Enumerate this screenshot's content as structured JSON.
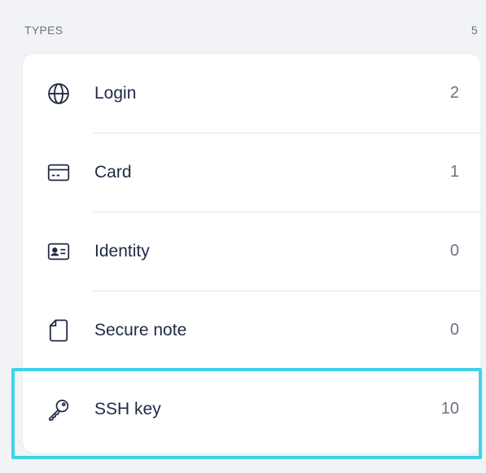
{
  "section": {
    "title": "TYPES",
    "count": "5"
  },
  "types": [
    {
      "label": "Login",
      "count": "2",
      "icon": "globe-icon"
    },
    {
      "label": "Card",
      "count": "1",
      "icon": "credit-card-icon"
    },
    {
      "label": "Identity",
      "count": "0",
      "icon": "id-card-icon"
    },
    {
      "label": "Secure note",
      "count": "0",
      "icon": "note-icon"
    },
    {
      "label": "SSH key",
      "count": "10",
      "icon": "key-icon",
      "highlighted": true
    }
  ],
  "colors": {
    "highlight": "#3fd3e6",
    "text": "#1f2a44",
    "muted": "#6b7280",
    "background": "#f2f3f6",
    "card": "#ffffff"
  }
}
